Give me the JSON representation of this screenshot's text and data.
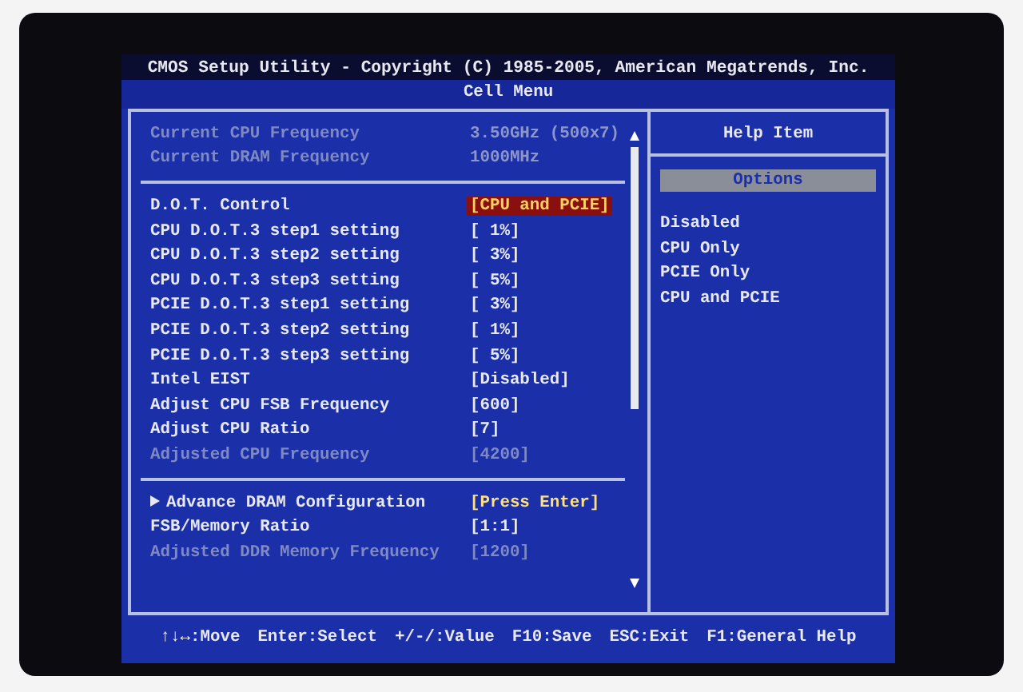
{
  "header": {
    "title": "CMOS Setup Utility - Copyright (C) 1985-2005, American Megatrends, Inc.",
    "menu": "Cell Menu"
  },
  "sections": [
    {
      "items": [
        {
          "kind": "info",
          "label": "Current CPU Frequency",
          "value": "3.50GHz (500x7)",
          "disabled": true,
          "selected": false
        },
        {
          "kind": "info",
          "label": "Current DRAM Frequency",
          "value": "1000MHz",
          "disabled": true,
          "selected": false
        }
      ]
    },
    {
      "items": [
        {
          "kind": "setting",
          "label": "D.O.T. Control",
          "value": "[CPU and PCIE]",
          "disabled": false,
          "selected": true
        },
        {
          "kind": "setting",
          "label": "CPU D.O.T.3 step1 setting",
          "value": "[ 1%]",
          "disabled": false,
          "selected": false
        },
        {
          "kind": "setting",
          "label": "CPU D.O.T.3 step2 setting",
          "value": "[ 3%]",
          "disabled": false,
          "selected": false
        },
        {
          "kind": "setting",
          "label": "CPU D.O.T.3 step3 setting",
          "value": "[ 5%]",
          "disabled": false,
          "selected": false
        },
        {
          "kind": "setting",
          "label": "PCIE D.O.T.3 step1 setting",
          "value": "[ 3%]",
          "disabled": false,
          "selected": false
        },
        {
          "kind": "setting",
          "label": "PCIE D.O.T.3 step2 setting",
          "value": "[ 1%]",
          "disabled": false,
          "selected": false
        },
        {
          "kind": "setting",
          "label": "PCIE D.O.T.3 step3 setting",
          "value": "[ 5%]",
          "disabled": false,
          "selected": false
        },
        {
          "kind": "setting",
          "label": "Intel EIST",
          "value": "[Disabled]",
          "disabled": false,
          "selected": false
        },
        {
          "kind": "setting",
          "label": "Adjust CPU FSB Frequency",
          "value": "[600]",
          "disabled": false,
          "selected": false
        },
        {
          "kind": "setting",
          "label": "Adjust CPU Ratio",
          "value": "[7]",
          "disabled": false,
          "selected": false
        },
        {
          "kind": "setting",
          "label": "Adjusted CPU Frequency",
          "value": "[4200]",
          "disabled": true,
          "selected": false
        }
      ]
    },
    {
      "items": [
        {
          "kind": "submenu",
          "label": "Advance DRAM Configuration",
          "value": "[Press Enter]",
          "disabled": false,
          "selected": false
        },
        {
          "kind": "setting",
          "label": "FSB/Memory Ratio",
          "value": "[1:1]",
          "disabled": false,
          "selected": false
        },
        {
          "kind": "setting",
          "label": "Adjusted DDR Memory Frequency",
          "value": "[1200]",
          "disabled": true,
          "selected": false
        }
      ]
    }
  ],
  "help": {
    "title": "Help Item",
    "options_heading": "Options",
    "options": [
      "Disabled",
      "CPU Only",
      "PCIE Only",
      "CPU and PCIE"
    ]
  },
  "footer": [
    "↑↓↔:Move",
    "Enter:Select",
    "+/-/:Value",
    "F10:Save",
    "ESC:Exit",
    "F1:General Help"
  ]
}
